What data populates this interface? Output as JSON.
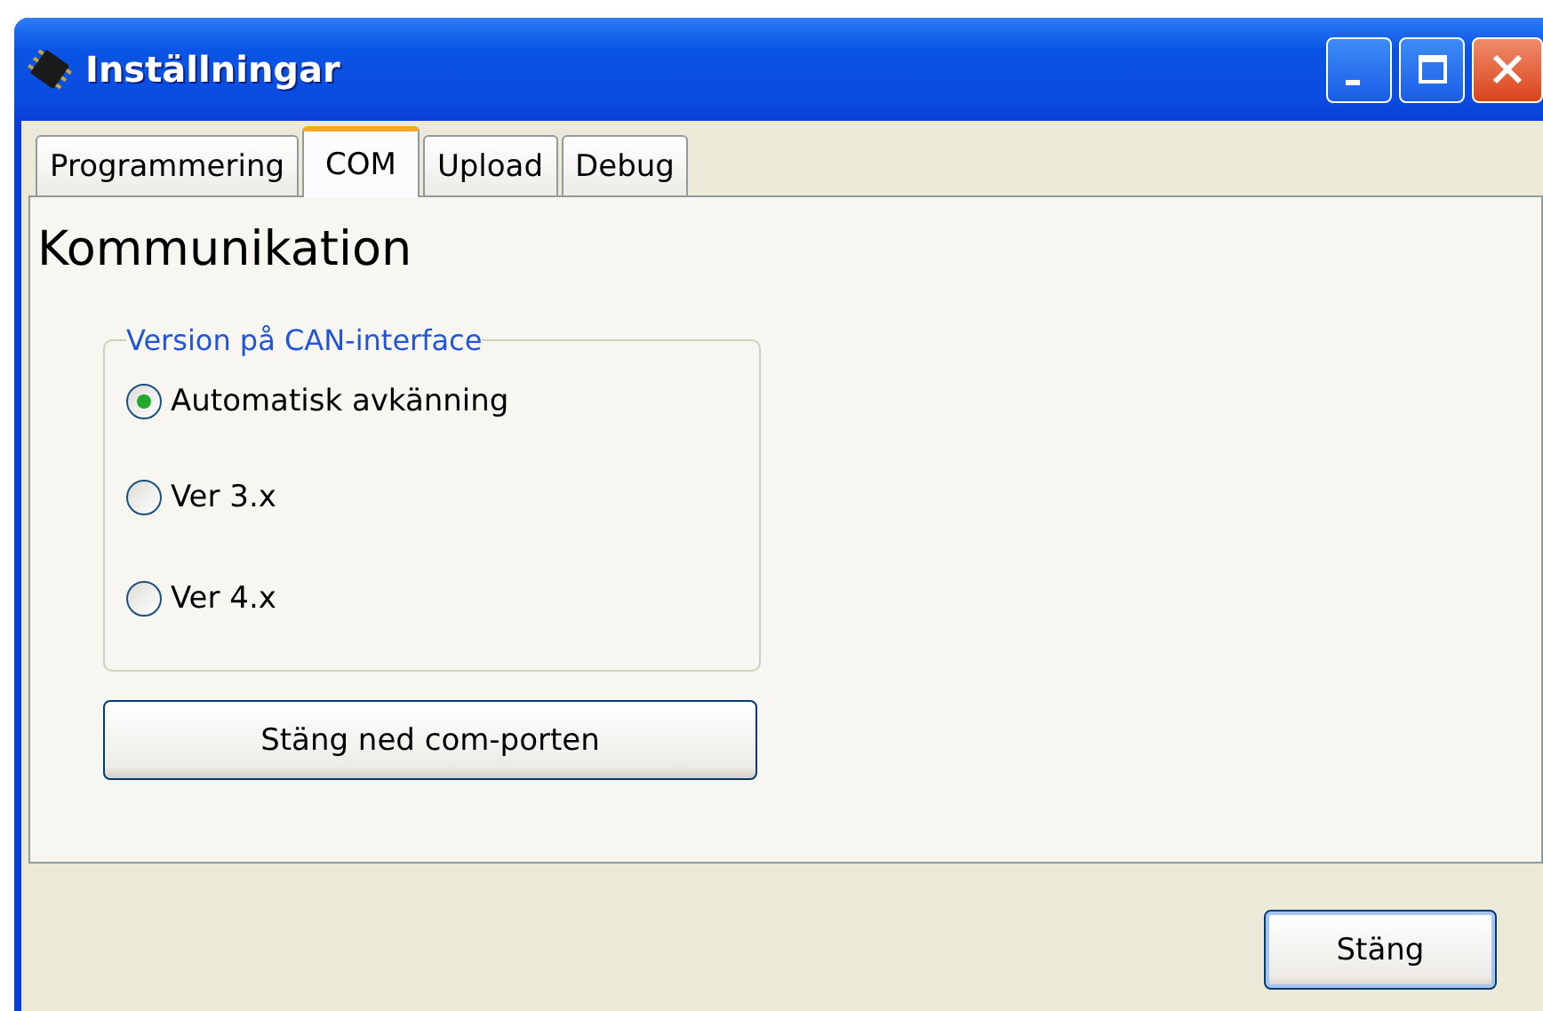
{
  "window": {
    "title": "Inställningar"
  },
  "tabs": [
    {
      "label": "Programmering",
      "selected": false
    },
    {
      "label": "COM",
      "selected": true
    },
    {
      "label": "Upload",
      "selected": false
    },
    {
      "label": "Debug",
      "selected": false
    }
  ],
  "panel": {
    "heading": "Kommunikation",
    "group": {
      "legend": "Version på CAN-interface",
      "options": [
        {
          "label": "Automatisk avkänning",
          "selected": true
        },
        {
          "label": "Ver 3.x",
          "selected": false
        },
        {
          "label": "Ver 4.x",
          "selected": false
        }
      ]
    },
    "button": "Stäng ned com-porten"
  },
  "footer": {
    "button": "Stäng"
  }
}
